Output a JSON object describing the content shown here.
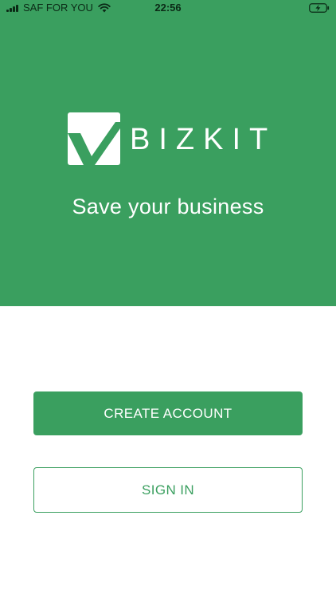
{
  "status_bar": {
    "carrier": "SAF FOR YOU",
    "time": "22:56",
    "icons": [
      "signal-icon",
      "wifi-icon",
      "battery-charging-icon"
    ]
  },
  "hero": {
    "brand": "BIZKIT",
    "tagline": "Save your business",
    "logo_icon": "check-mark-logo"
  },
  "actions": {
    "create_account": "CREATE ACCOUNT",
    "sign_in": "SIGN IN"
  },
  "colors": {
    "brand_green": "#3a9f5f",
    "white": "#ffffff"
  }
}
